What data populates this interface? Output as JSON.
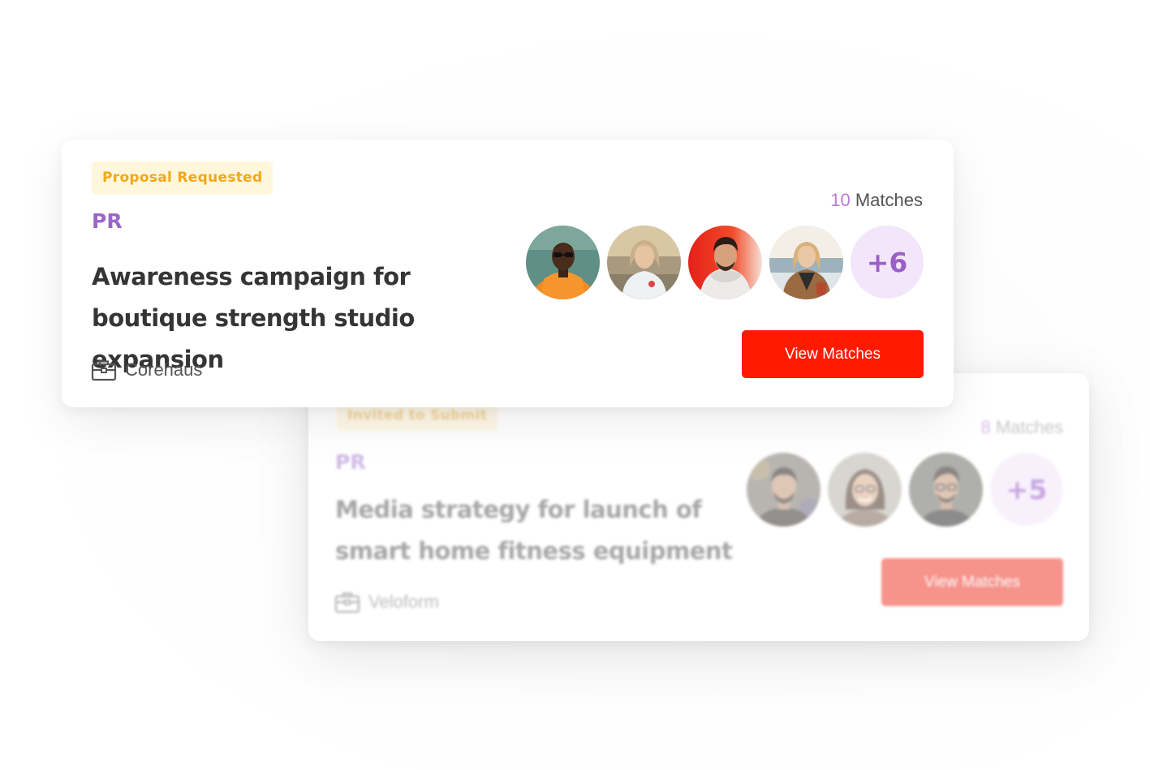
{
  "cards": [
    {
      "status": "Proposal Requested",
      "category": "PR",
      "title": "Awareness campaign for boutique strength studio expansion",
      "company": "Corehaus",
      "matches_number": "10",
      "matches_label": "Matches",
      "avatars": [
        "avatar-orange-hoodie",
        "avatar-white-tee",
        "avatar-white-hoodie",
        "avatar-brown-jacket"
      ],
      "more_count": "+6",
      "cta_label": "View Matches"
    },
    {
      "status": "Invited to Submit",
      "category": "PR",
      "title": "Media strategy for launch of smart home fitness equipment",
      "company": "Veloform",
      "matches_number": "8",
      "matches_label": "Matches",
      "avatars": [
        "avatar-man-beard",
        "avatar-woman-glasses",
        "avatar-man-glasses"
      ],
      "more_count": "+5",
      "cta_label": "View Matches"
    }
  ],
  "colors": {
    "badge_bg": "#fff6dc",
    "badge_text": "#f2a818",
    "category": "#9a66c9",
    "accent_purple_light": "#f3e6fb",
    "cta": "#ff1a00"
  }
}
